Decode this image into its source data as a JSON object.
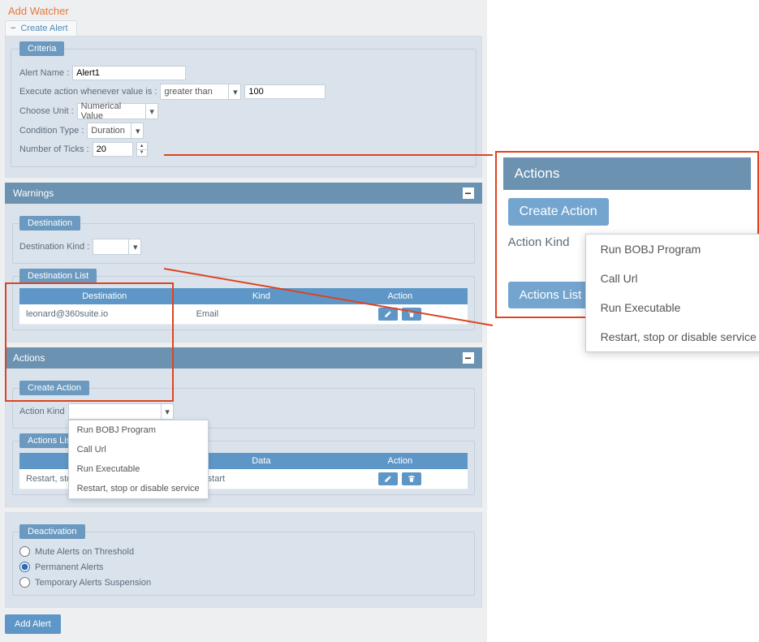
{
  "title": "Add Watcher",
  "tab": {
    "label": "Create Alert"
  },
  "criteria": {
    "legend": "Criteria",
    "alert_name_label": "Alert Name :",
    "alert_name_value": "Alert1",
    "exec_action_label": "Execute action whenever value is :",
    "exec_action_op": "greater than",
    "exec_action_val": "100",
    "choose_unit_label": "Choose Unit :",
    "choose_unit_value": "Numerical Value",
    "cond_type_label": "Condition Type :",
    "cond_type_value": "Duration",
    "ticks_label": "Number of Ticks :",
    "ticks_value": "20"
  },
  "warnings": {
    "header": "Warnings",
    "destination_legend": "Destination",
    "dest_kind_label": "Destination Kind :",
    "dest_list_legend": "Destination List",
    "cols": [
      "Destination",
      "Kind",
      "Action"
    ],
    "row": {
      "dest": "leonard@360suite.io",
      "kind": "Email"
    }
  },
  "actions": {
    "header": "Actions",
    "create_action": "Create Action",
    "action_kind_label": "Action Kind",
    "dropdown_items": [
      "Run BOBJ Program",
      "Call Url",
      "Run Executable",
      "Restart, stop or disable service"
    ],
    "actions_list": "Actions List",
    "cols": [
      "",
      "Data",
      "Action"
    ],
    "row": {
      "kind": "Restart, stop or disable service",
      "data": "Restart"
    }
  },
  "deactivation": {
    "legend": "Deactivation",
    "opts": [
      "Mute Alerts on Threshold",
      "Permanent Alerts",
      "Temporary Alerts Suspension"
    ],
    "selected_index": 1
  },
  "add_alert": "Add Alert",
  "zoom": {
    "header": "Actions",
    "create_action": "Create Action",
    "action_kind_label": "Action Kind",
    "dropdown_items": [
      "Run BOBJ Program",
      "Call Url",
      "Run Executable",
      "Restart, stop or disable service"
    ],
    "actions_list": "Actions List"
  }
}
